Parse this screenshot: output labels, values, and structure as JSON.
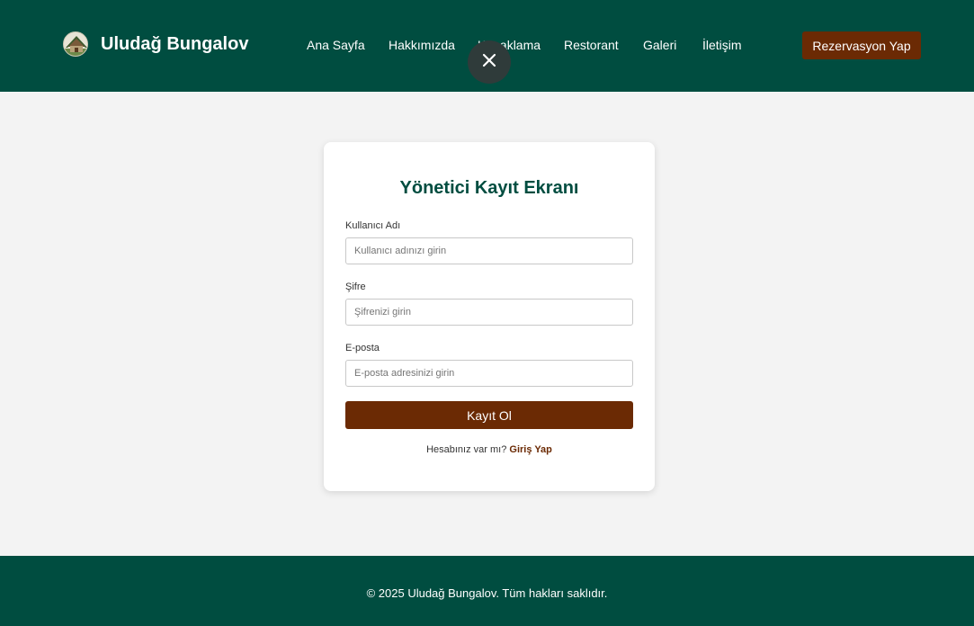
{
  "header": {
    "brand_name": "Uludağ Bungalov",
    "logo_icon": "bungalow-logo-icon",
    "nav": [
      {
        "label": "Ana Sayfa"
      },
      {
        "label": "Hakkımızda"
      },
      {
        "label": "Konaklama"
      },
      {
        "label": "Restorant"
      },
      {
        "label": "Galeri"
      },
      {
        "label": "İletişim"
      }
    ],
    "reserve_label": "Rezervasyon Yap",
    "close_icon": "close-icon"
  },
  "form": {
    "title": "Yönetici Kayıt Ekranı",
    "username": {
      "label": "Kullanıcı Adı",
      "placeholder": "Kullanıcı adınızı girin",
      "value": ""
    },
    "password": {
      "label": "Şifre",
      "placeholder": "Şifrenizi girin",
      "value": ""
    },
    "email": {
      "label": "E-posta",
      "placeholder": "E-posta adresinizi girin",
      "value": ""
    },
    "submit_label": "Kayıt Ol",
    "login_prompt": "Hesabınız var mı?",
    "login_link": "Giriş Yap"
  },
  "footer": {
    "text": "© 2025 Uludağ Bungalov. Tüm hakları saklıdır."
  },
  "colors": {
    "primary": "#004d40",
    "accent": "#6b2a04",
    "background": "#f3f3f3",
    "card": "#ffffff"
  }
}
